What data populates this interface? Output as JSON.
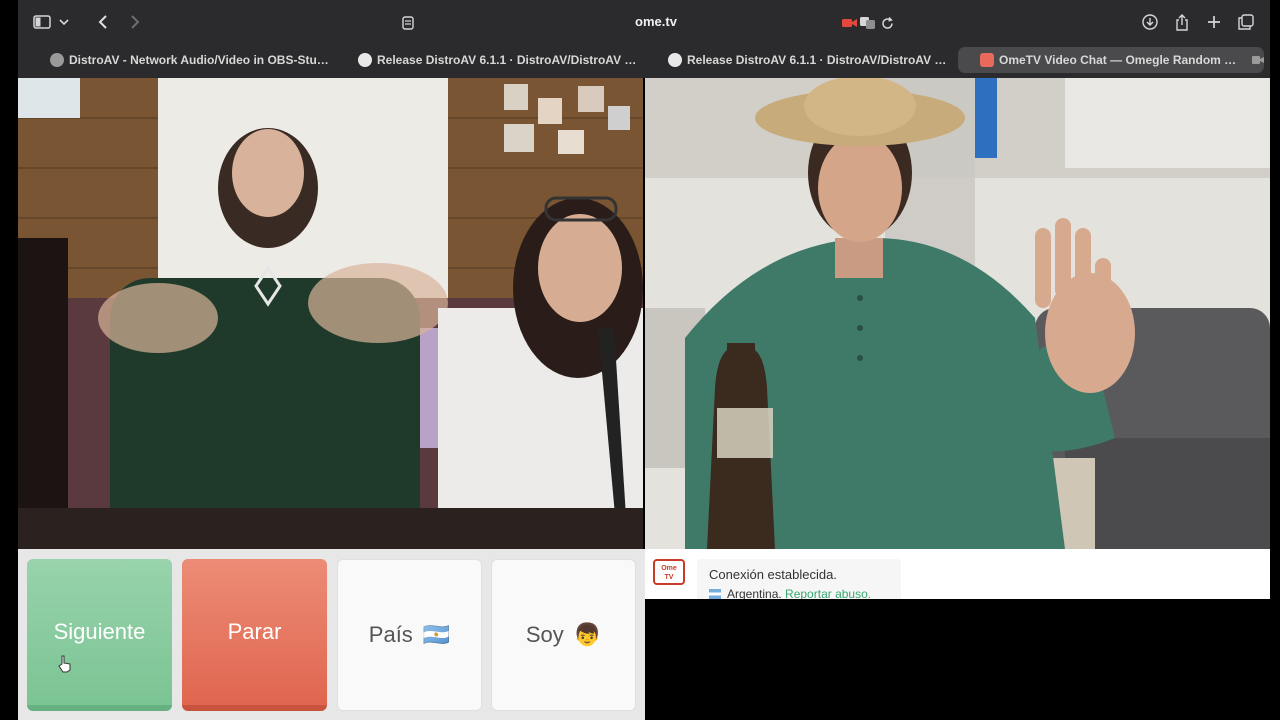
{
  "browser": {
    "url": "ome.tv",
    "tabs": [
      {
        "label": "DistroAV - Network Audio/Video in OBS-Studio...",
        "active": false
      },
      {
        "label": "Release DistroAV 6.1.1 · DistroAV/DistroAV · GitH...",
        "active": false
      },
      {
        "label": "Release DistroAV 6.1.1 · DistroAV/DistroAV · GitH...",
        "active": false
      },
      {
        "label": "OmeTV Video Chat — Omegle Random Ca...",
        "active": true
      }
    ],
    "icons": [
      "sidebar-icon",
      "chevron-down-icon",
      "back-icon",
      "forward-icon",
      "site-settings-icon",
      "camera-icon",
      "translate-icon",
      "reload-icon",
      "download-icon",
      "share-icon",
      "new-tab-icon",
      "tab-overview-icon"
    ],
    "colors": {
      "chrome": "#2b2b2d",
      "active_tab": "#4a4a4d"
    }
  },
  "controls": {
    "next_label": "Siguiente",
    "stop_label": "Parar",
    "country_label": "País",
    "country_flag": "🇦🇷",
    "gender_label": "Soy",
    "gender_emoji": "👦"
  },
  "chat": {
    "status": "Conexión establecida.",
    "country": "Argentina.",
    "report_link": "Reportar abuso."
  },
  "colors": {
    "next": "#7bc493",
    "stop": "#e0664f",
    "link": "#3aa774",
    "logo": "#c93b28"
  }
}
